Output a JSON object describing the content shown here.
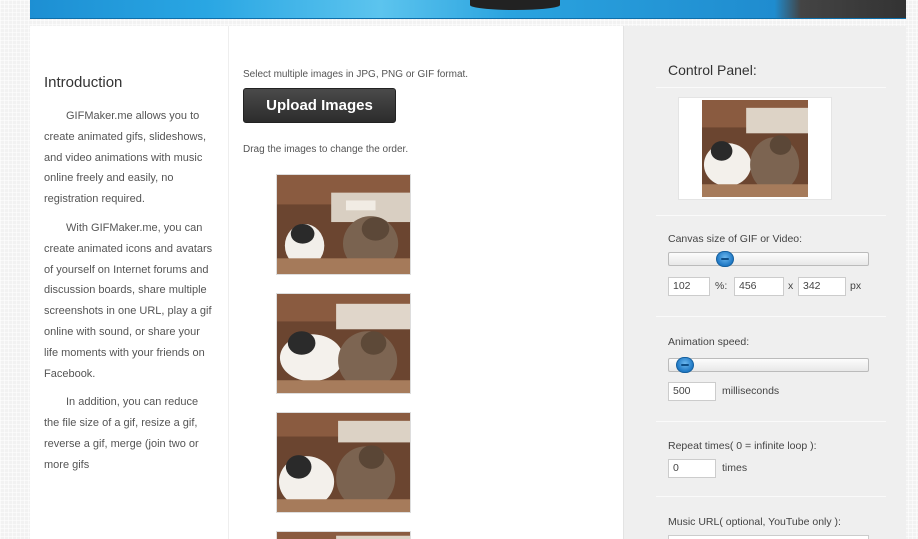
{
  "intro": {
    "title": "Introduction",
    "paragraphs": [
      "GIFMaker.me allows you to create animated gifs, slideshows, and video animations with music online freely and easily, no registration required.",
      "With GIFMaker.me, you can create animated icons and avatars of yourself on Internet forums and discussion boards, share multiple screenshots in one URL, play a gif online with sound, or share your life moments with your friends on Facebook.",
      "In addition, you can reduce the file size of a gif, resize a gif, reverse a gif, merge (join two or more gifs"
    ]
  },
  "main": {
    "select_text": "Select multiple images in JPG, PNG or GIF format.",
    "upload_label": "Upload Images",
    "drag_text": "Drag the images to change the order."
  },
  "control": {
    "title": "Control Panel:",
    "canvas_label": "Canvas size of GIF or Video:",
    "canvas_percent": "102",
    "canvas_percent_sep": "%:",
    "canvas_width": "456",
    "canvas_x": "x",
    "canvas_height": "342",
    "canvas_unit": "px",
    "canvas_slider_value": 0.28,
    "speed_label": "Animation speed:",
    "speed_value": "500",
    "speed_unit": "milliseconds",
    "speed_slider_value": 0.08,
    "repeat_label": "Repeat times( 0 = infinite loop ):",
    "repeat_value": "0",
    "repeat_unit": "times",
    "music_label": "Music URL( optional, YouTube only ):"
  },
  "colors": {
    "accent_blue": "#1f8ccf",
    "button_dark": "#333333",
    "panel_bg": "#efefef"
  }
}
